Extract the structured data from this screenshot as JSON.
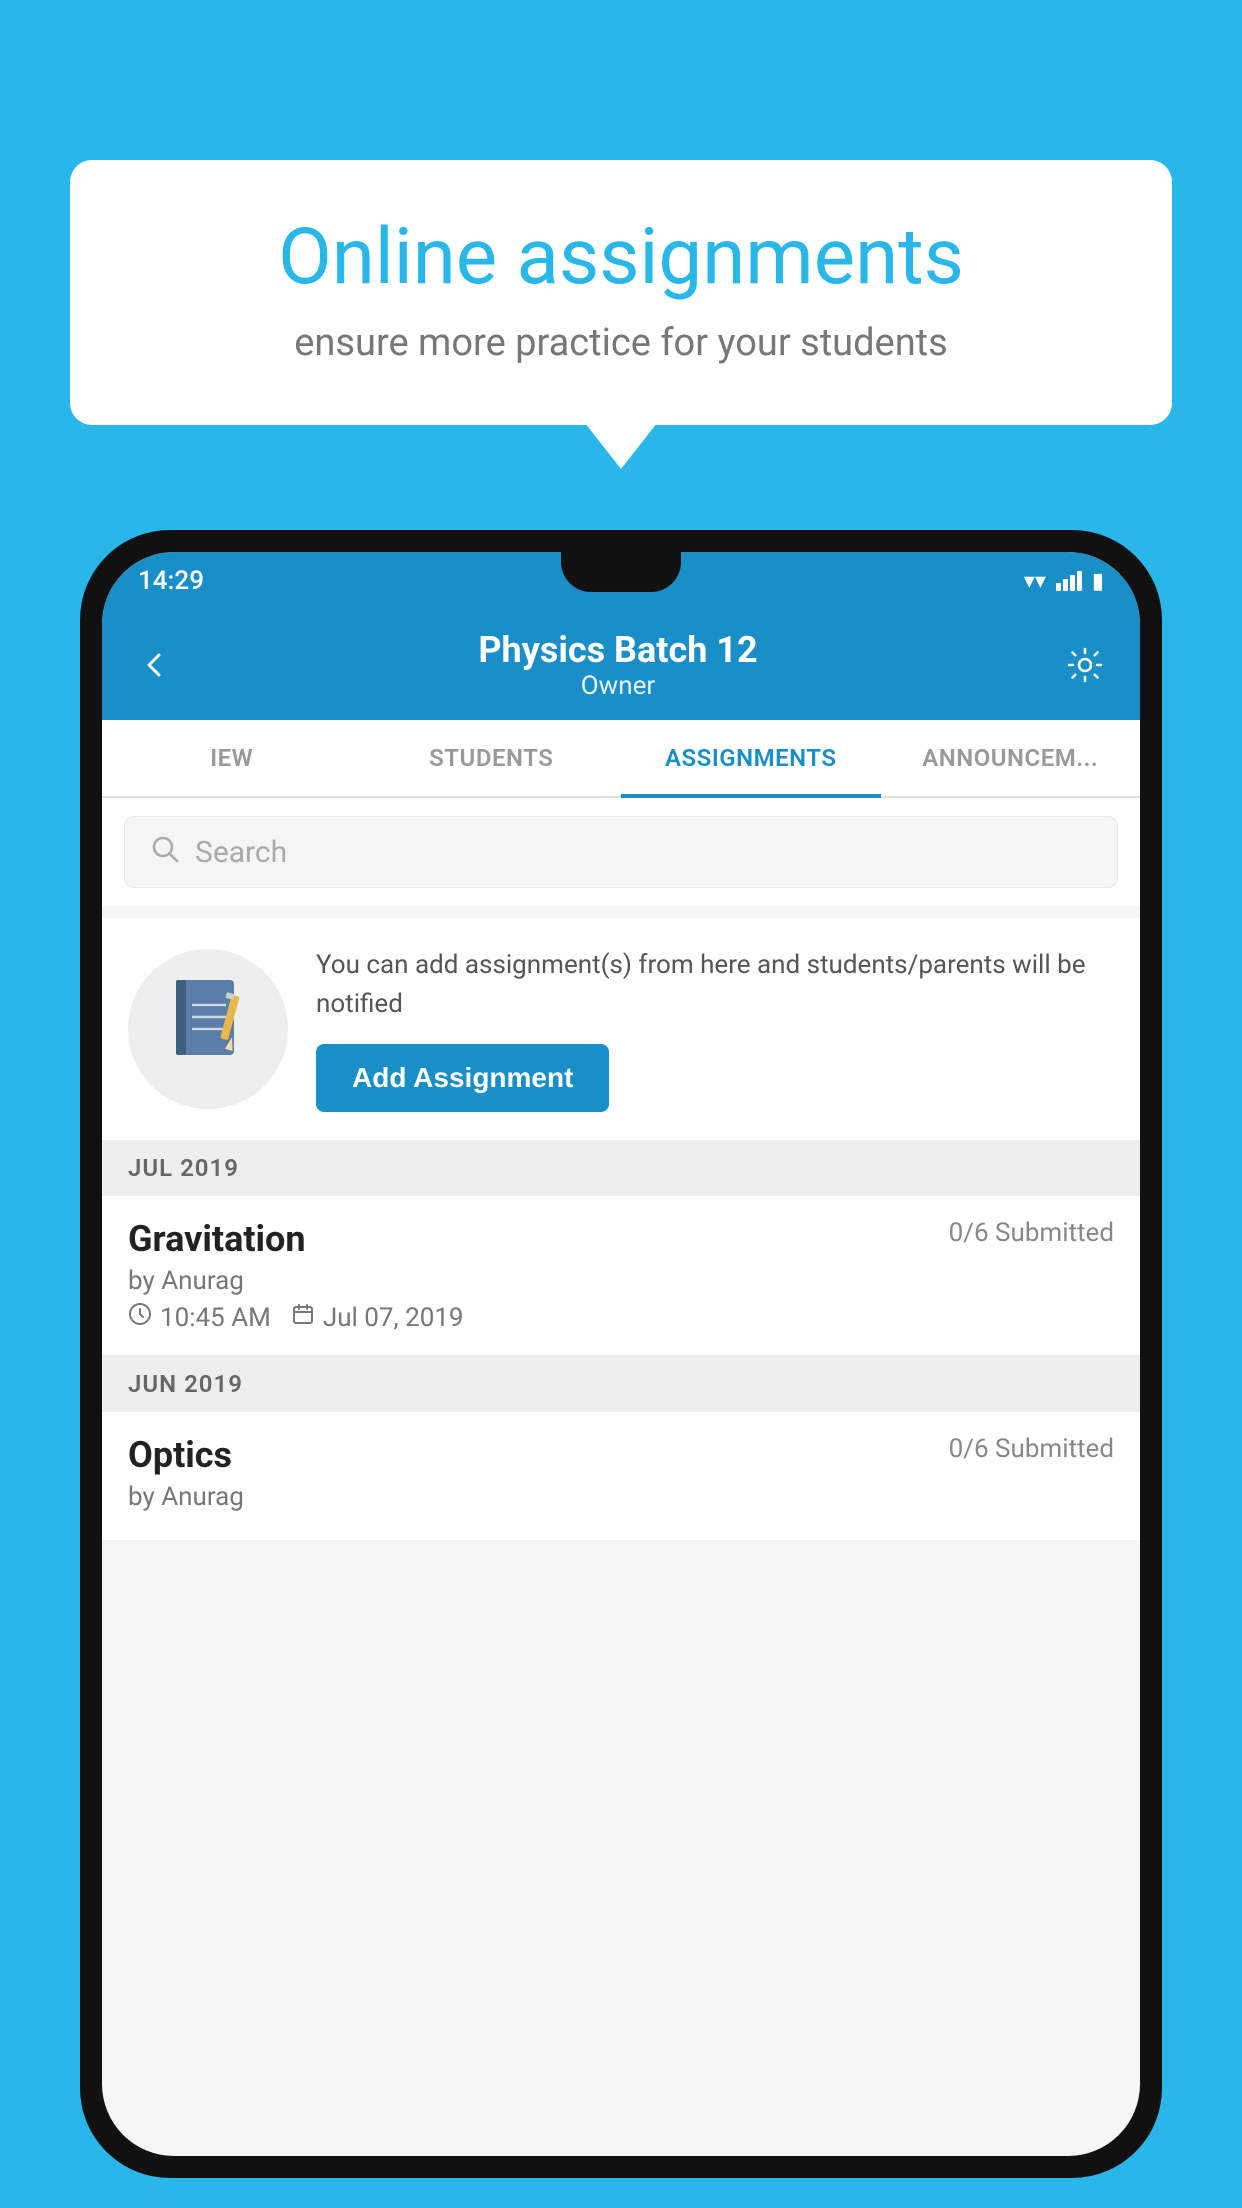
{
  "background_color": "#29b6e8",
  "speech_bubble": {
    "title": "Online assignments",
    "subtitle": "ensure more practice for your students"
  },
  "phone": {
    "status_bar": {
      "time": "14:29",
      "wifi": true,
      "signal": true,
      "battery": true
    },
    "header": {
      "title": "Physics Batch 12",
      "subtitle": "Owner"
    },
    "tabs": [
      {
        "label": "IEW",
        "active": false
      },
      {
        "label": "STUDENTS",
        "active": false
      },
      {
        "label": "ASSIGNMENTS",
        "active": true
      },
      {
        "label": "ANNOUNCEM...",
        "active": false
      }
    ],
    "search": {
      "placeholder": "Search"
    },
    "promo": {
      "description": "You can add assignment(s) from here and students/parents will be notified",
      "button_label": "Add Assignment"
    },
    "sections": [
      {
        "label": "JUL 2019",
        "assignments": [
          {
            "title": "Gravitation",
            "submitted": "0/6 Submitted",
            "by": "by Anurag",
            "time": "10:45 AM",
            "date": "Jul 07, 2019"
          }
        ]
      },
      {
        "label": "JUN 2019",
        "assignments": [
          {
            "title": "Optics",
            "submitted": "0/6 Submitted",
            "by": "by Anurag",
            "time": "",
            "date": ""
          }
        ]
      }
    ]
  }
}
